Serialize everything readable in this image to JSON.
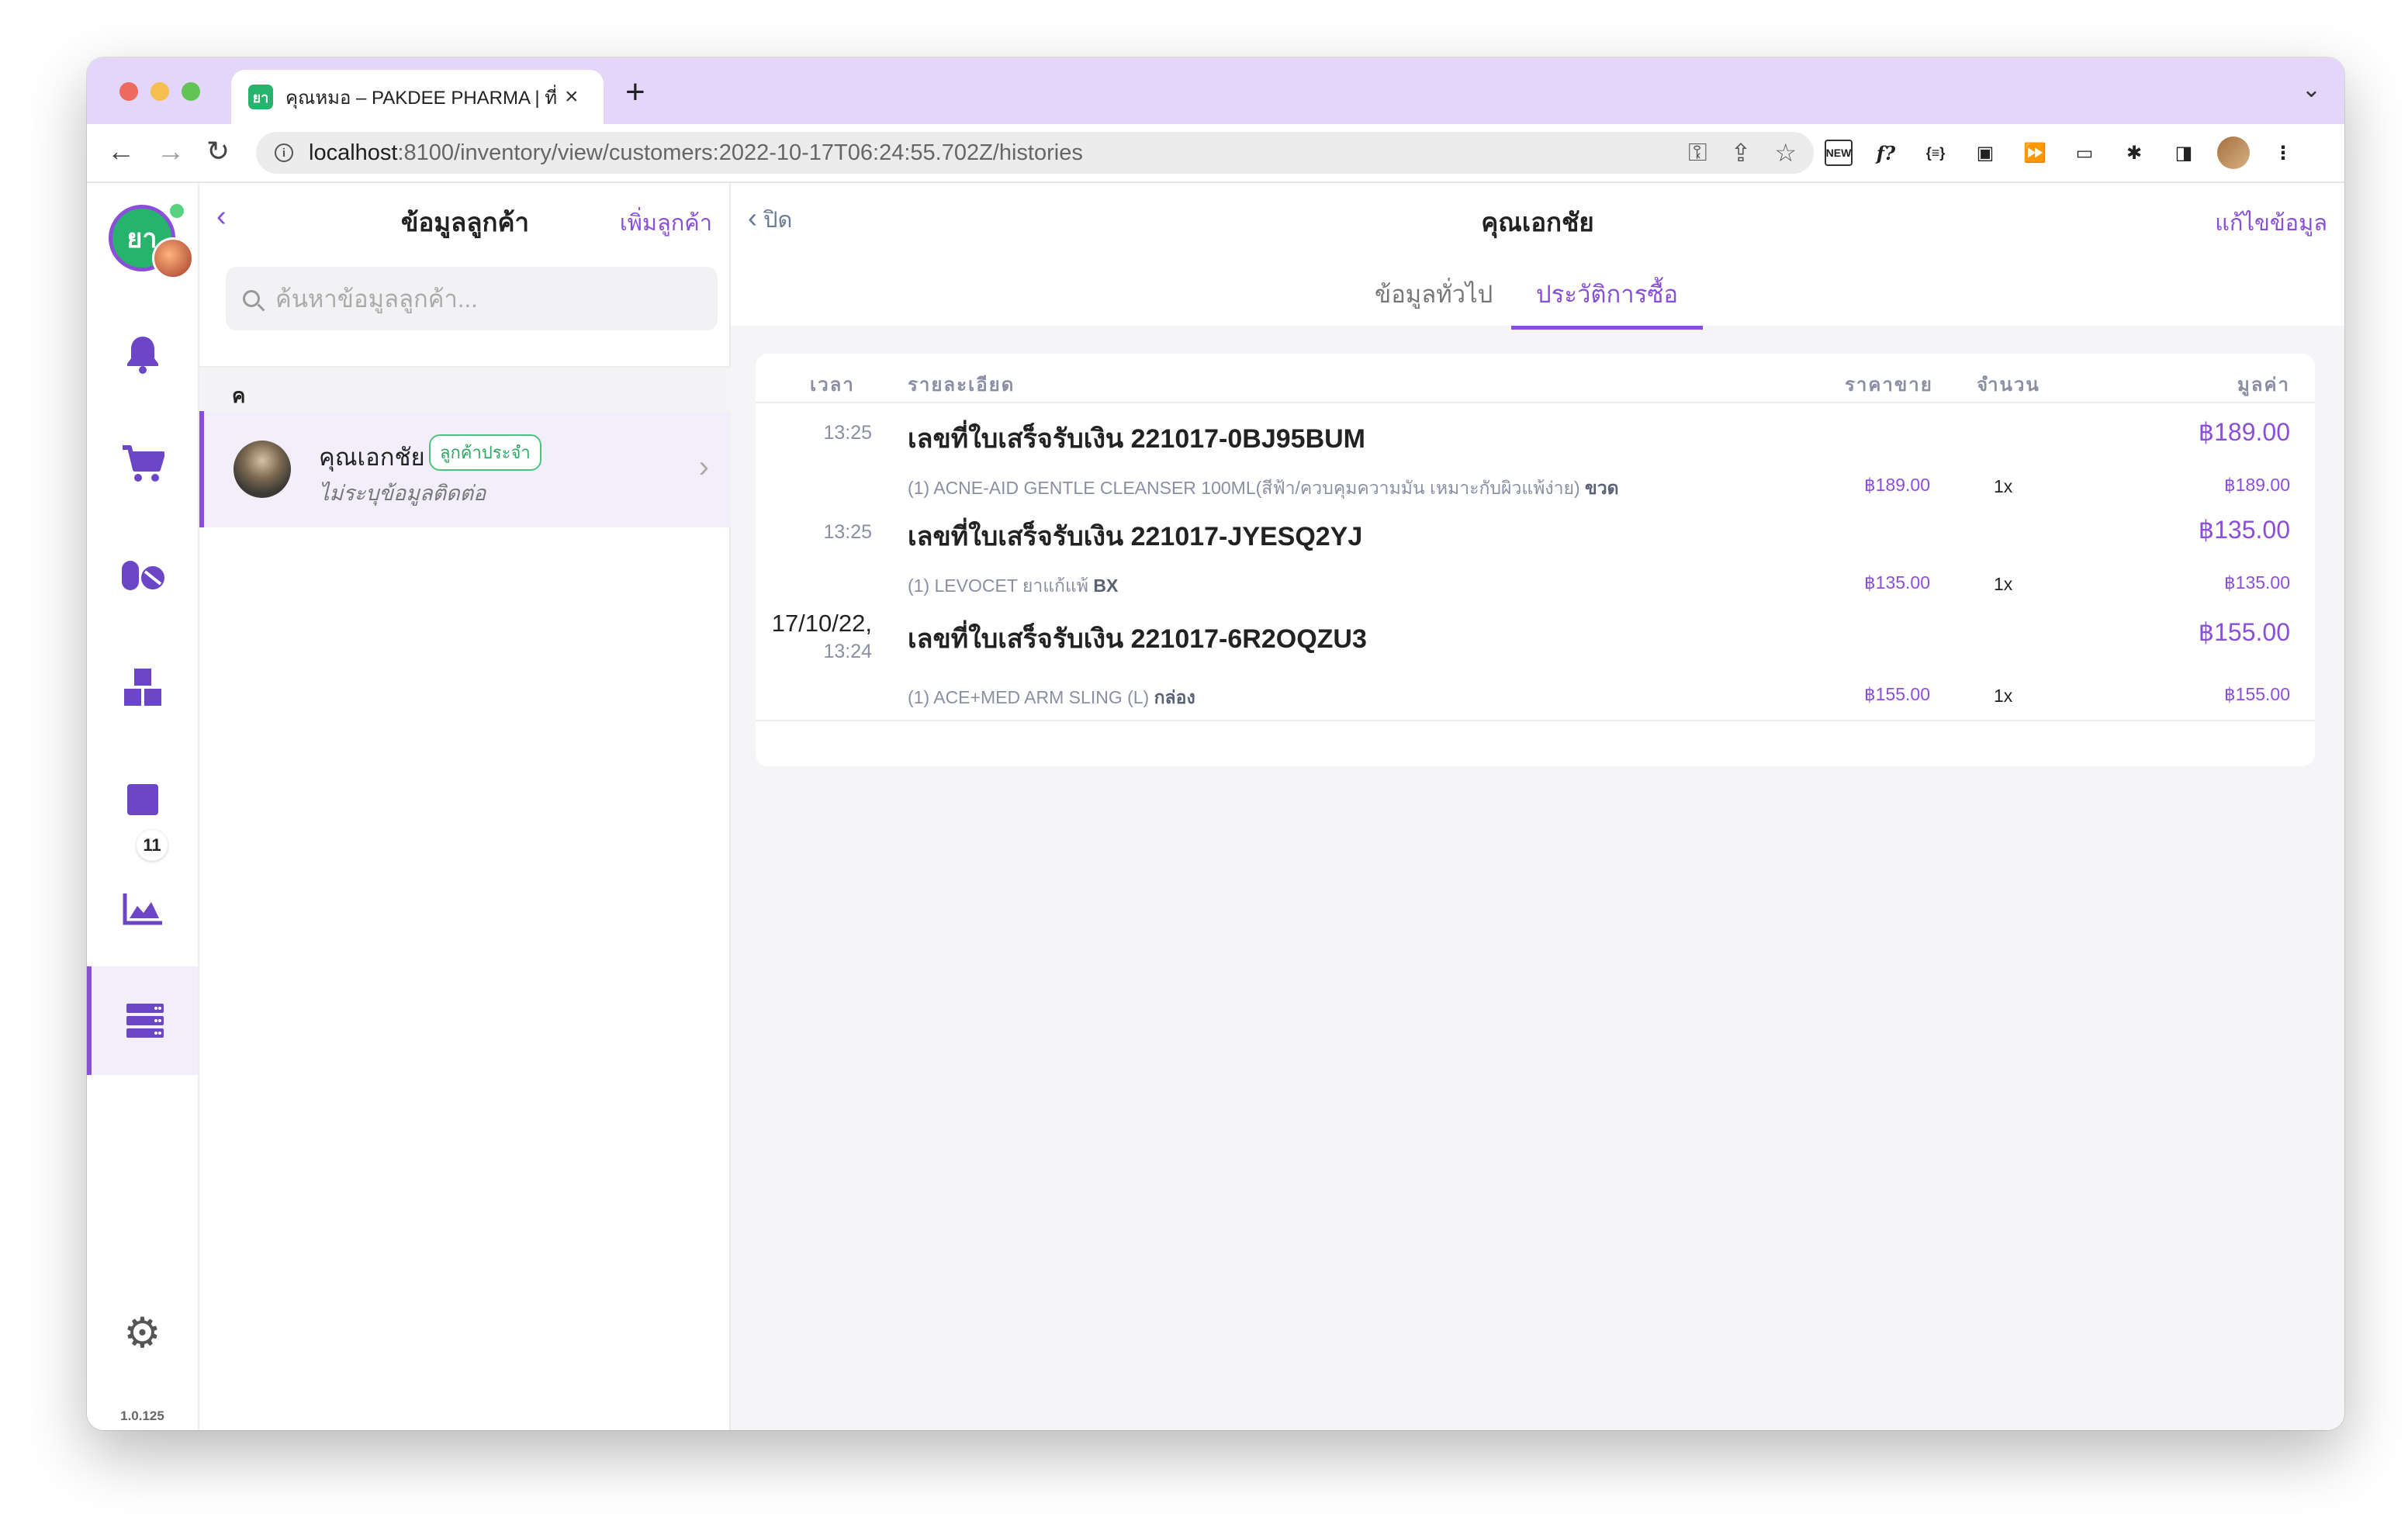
{
  "browser": {
    "tab_title": "คุณหมอ – PAKDEE PHARMA | ที่",
    "favicon_text": "ยา",
    "url_host": "localhost",
    "url_rest": ":8100/inventory/view/customers:2022-10-17T06:24:55.702Z/histories",
    "ext_new_label": "NEW",
    "ext_f_label": "f?",
    "ext_json_label": "{≡}"
  },
  "rail": {
    "logo_text": "ยา",
    "badge_count": "11",
    "version": "1.0.125",
    "accent": "#8a4fd9"
  },
  "list": {
    "title": "ข้อมูลลูกค้า",
    "add_label": "เพิ่มลูกค้า",
    "search_placeholder": "ค้นหาข้อมูลลูกค้า...",
    "group_letter": "ค",
    "customers": [
      {
        "name": "คุณเอกชัย",
        "tag": "ลูกค้าประจำ",
        "subtitle": "ไม่ระบุข้อมูลติดต่อ"
      }
    ]
  },
  "detail": {
    "close_label": "ปิด",
    "title": "คุณเอกชัย",
    "edit_label": "แก้ไขข้อมูล",
    "tabs": [
      {
        "label": "ข้อมูลทั่วไป",
        "active": false
      },
      {
        "label": "ประวัติการซื้อ",
        "active": true
      }
    ],
    "columns": {
      "time": "เวลา",
      "detail": "รายละเอียด",
      "price": "ราคาขาย",
      "qty": "จำนวน",
      "value": "มูลค่า"
    },
    "receipts": [
      {
        "date": "",
        "time": "13:25",
        "title": "เลขที่ใบเสร็จรับเงิน 221017-0BJ95BUM",
        "total": "฿189.00",
        "items": [
          {
            "name": "(1) ACNE-AID GENTLE CLEANSER 100ML(สีฟ้า/ควบคุมความมัน เหมาะกับผิวแพ้ง่าย)",
            "unit": "ขวด",
            "price": "฿189.00",
            "qty": "1x",
            "value": "฿189.00"
          }
        ]
      },
      {
        "date": "",
        "time": "13:25",
        "title": "เลขที่ใบเสร็จรับเงิน 221017-JYESQ2YJ",
        "total": "฿135.00",
        "items": [
          {
            "name": "(1) LEVOCET ยาแก้แพ้",
            "unit": "BX",
            "price": "฿135.00",
            "qty": "1x",
            "value": "฿135.00"
          }
        ]
      },
      {
        "date": "17/10/22,",
        "time": "13:24",
        "title": "เลขที่ใบเสร็จรับเงิน 221017-6R2OQZU3",
        "total": "฿155.00",
        "items": [
          {
            "name": "(1) ACE+MED ARM SLING (L)",
            "unit": "กล่อง",
            "price": "฿155.00",
            "qty": "1x",
            "value": "฿155.00"
          }
        ]
      }
    ]
  }
}
